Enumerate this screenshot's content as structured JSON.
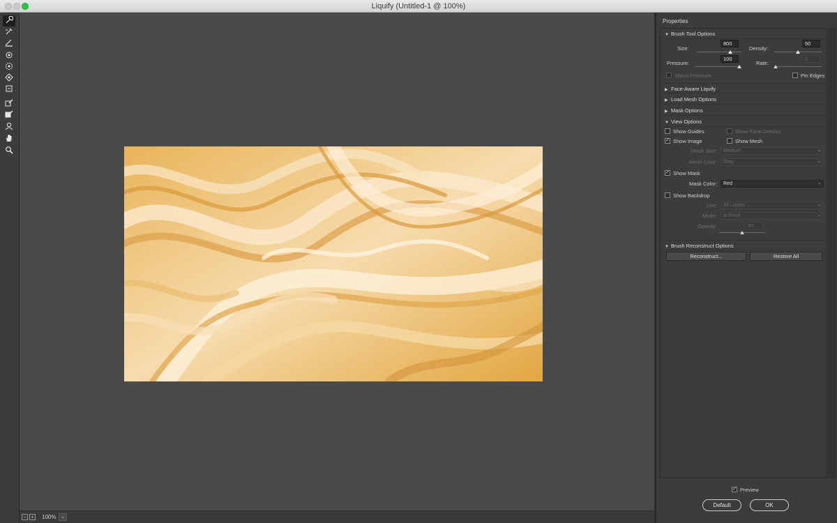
{
  "window": {
    "title": "Liquify (Untitled-1 @ 100%)"
  },
  "toolbar": {
    "tools": [
      "forward-warp-tool-icon",
      "reconstruct-tool-icon",
      "smooth-tool-icon",
      "twirl-clockwise-tool-icon",
      "pucker-tool-icon",
      "bloat-tool-icon",
      "push-left-tool-icon",
      "freeze-mask-tool-icon",
      "thaw-mask-tool-icon",
      "face-tool-icon",
      "hand-tool-icon",
      "zoom-tool-icon"
    ]
  },
  "status": {
    "zoom": "100%"
  },
  "panel": {
    "title": "Properties",
    "brush": {
      "header": "Brush Tool Options",
      "size_label": "Size:",
      "size_value": "800",
      "size_level": 0.75,
      "density_label": "Density:",
      "density_value": "50",
      "density_level": 0.5,
      "pressure_label": "Pressure:",
      "pressure_value": "100",
      "pressure_level": 1.0,
      "rate_label": "Rate:",
      "rate_value": "0",
      "rate_level": 0.0,
      "stylus_label": "Stylus Pressure",
      "pin_edges_label": "Pin Edges"
    },
    "sections": {
      "face_aware": "Face-Aware Liquify",
      "load_mesh": "Load Mesh Options",
      "mask": "Mask Options",
      "view": "View Options",
      "reconstruct": "Brush Reconstruct Options"
    },
    "view": {
      "show_guides": "Show Guides",
      "show_face_overlay": "Show Face Overlay",
      "show_image": "Show Image",
      "show_mesh": "Show Mesh",
      "mesh_size_label": "Mesh Size:",
      "mesh_size_value": "Medium",
      "mesh_color_label": "Mesh Color:",
      "mesh_color_value": "Gray",
      "show_mask": "Show Mask",
      "mask_color_label": "Mask Color:",
      "mask_color_value": "Red",
      "show_backdrop": "Show Backdrop",
      "use_label": "Use:",
      "use_value": "All Layers",
      "mode_label": "Mode:",
      "mode_value": "In Front",
      "opacity_label": "Opacity:",
      "opacity_value": "50",
      "opacity_level": 0.5
    },
    "reconstruct": {
      "reconstruct_label": "Reconstruct...",
      "restore_all_label": "Restore All"
    },
    "preview_label": "Preview",
    "default_label": "Default",
    "ok_label": "OK"
  },
  "colors": {
    "canvas_bg": "#4a4a4a",
    "panel_bg": "#3c3c3c",
    "artwork_base": "#e8b25a",
    "close_btn": "#c9c9c9",
    "max_btn": "#2bc63f"
  }
}
